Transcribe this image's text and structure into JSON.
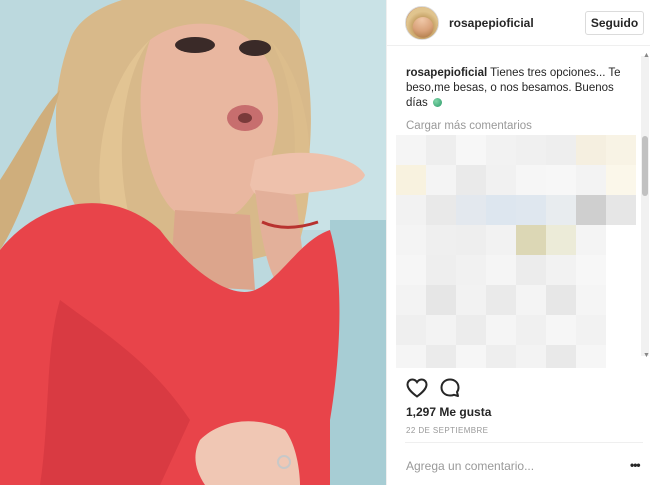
{
  "post": {
    "username": "rosapepioficial",
    "follow_label": "Seguido",
    "caption_user": "rosapepioficial",
    "caption_text": "Tienes tres opciones... Te beso,me besas, o nos besamos. Buenos días",
    "load_more": "Cargar más comentarios",
    "likes": "1,297 Me gusta",
    "date": "22 DE SEPTIEMBRE",
    "add_comment_placeholder": "Agrega un comentario...",
    "more_options": "•••"
  },
  "icons": {
    "like": "heart-outline-icon",
    "comment": "speech-bubble-icon",
    "caption_emoji": "globe-emoji-icon"
  },
  "colors": {
    "text": "#262626",
    "muted": "#999999",
    "border": "#dbdbdb",
    "dress": "#e8444a"
  },
  "pixelated_comments": [
    [
      "#f5f5f5",
      "#eeeeee",
      "#f7f7f7",
      "#f2f2f2",
      "#f0f0f0",
      "#eeeeee",
      "#f5efe0",
      "#f8f3e5"
    ],
    [
      "#f8f2df",
      "#f4f4f4",
      "#eaeaea",
      "#f1f1f1",
      "#f6f6f6",
      "#f7f7f7",
      "#f3f3f3",
      "#fbf7ea"
    ],
    [
      "#f2f2f2",
      "#e9e9e9",
      "#e3e8ee",
      "#dde6ef",
      "#dfe7ef",
      "#e8ecef",
      "#cfcfcf",
      "#e6e6e6"
    ],
    [
      "#f4f4f4",
      "#efefef",
      "#eeeeee",
      "#f2f2f2",
      "#dcd7b5",
      "#ecebd8",
      "#f4f4f4",
      "#ffffff"
    ],
    [
      "#f6f6f6",
      "#eeeeee",
      "#f1f1f1",
      "#f5f5f5",
      "#ececec",
      "#f2f2f2",
      "#f7f7f7",
      "#ffffff"
    ],
    [
      "#f3f3f3",
      "#e6e6e6",
      "#f2f2f2",
      "#eaeaea",
      "#f4f4f4",
      "#e7e7e7",
      "#f5f5f5",
      "#ffffff"
    ],
    [
      "#efefef",
      "#f3f3f3",
      "#ececec",
      "#f5f5f5",
      "#f0f0f0",
      "#f6f6f6",
      "#f2f2f2",
      "#ffffff"
    ],
    [
      "#f5f5f5",
      "#ebebeb",
      "#f6f6f6",
      "#eeeeee",
      "#f3f3f3",
      "#e9e9e9",
      "#f6f6f6",
      "#ffffff"
    ],
    [
      "#f0f0f0",
      "#f6f6f6",
      "#eaeaea",
      "#f4f4f4",
      "#eeeeee",
      "#f4f4f4",
      "#f1f1f1",
      "#ffffff"
    ],
    [
      "#f6f6f6",
      "#eeeeee",
      "#f3f3f3",
      "#ececec",
      "#f5f5f5",
      "#ececec",
      "#f7f7f7",
      "#ffffff"
    ],
    [
      "#f2f2f2",
      "#f5f5f5",
      "#ededed",
      "#f6f6f6",
      "#efefef",
      "#f5f5f5",
      "#f1f1f1",
      "#ffffff"
    ],
    [
      "#ffffff",
      "#ffffff",
      "#ffffff",
      "#ffffff",
      "#ffffff",
      "#ffffff",
      "#ffffff",
      "#ffffff"
    ]
  ]
}
